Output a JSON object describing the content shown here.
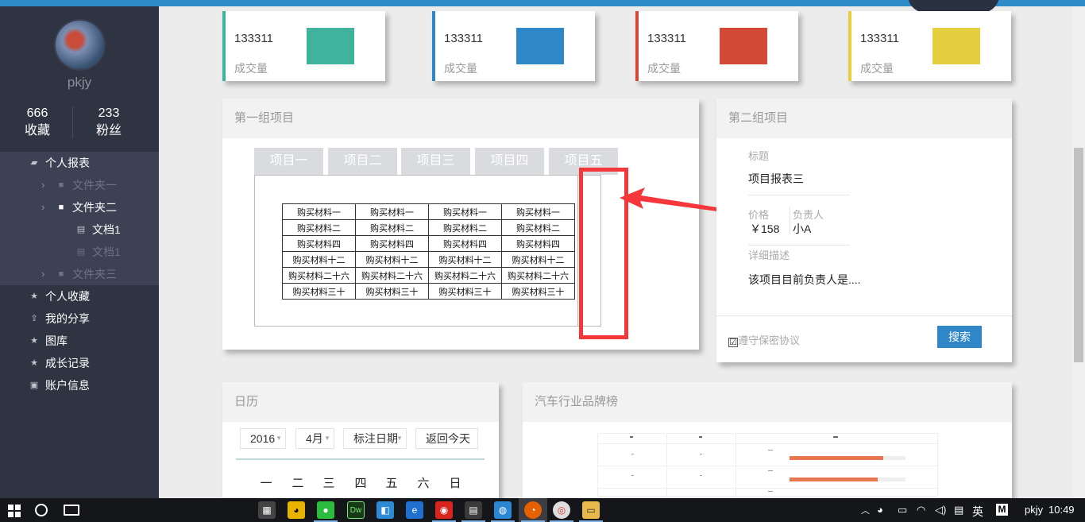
{
  "user": {
    "name": "pkjy",
    "favorites_count": "666",
    "favorites_label": "收藏",
    "fans_count": "233",
    "fans_label": "粉丝"
  },
  "sidebar": {
    "items": [
      {
        "label": "个人报表",
        "icon": "report-icon"
      },
      {
        "label": "文件夹一",
        "icon": "folder-icon"
      },
      {
        "label": "文件夹二",
        "icon": "folder-icon"
      },
      {
        "label": "文档1",
        "icon": "document-icon"
      },
      {
        "label": "文档1",
        "icon": "document-icon"
      },
      {
        "label": "文件夹三",
        "icon": "folder-icon"
      },
      {
        "label": "个人收藏",
        "icon": "star-icon"
      },
      {
        "label": "我的分享",
        "icon": "share-icon"
      },
      {
        "label": "图库",
        "icon": "star-icon"
      },
      {
        "label": "成长记录",
        "icon": "star-icon"
      },
      {
        "label": "账户信息",
        "icon": "account-icon"
      }
    ]
  },
  "stat_cards": [
    {
      "value": "133311",
      "label": "成交量",
      "color": "#3fb39b"
    },
    {
      "value": "133311",
      "label": "成交量",
      "color": "#2f87c7"
    },
    {
      "value": "133311",
      "label": "成交量",
      "color": "#d24a36"
    },
    {
      "value": "133311",
      "label": "成交量",
      "color": "#e5cf3f"
    }
  ],
  "group1": {
    "title": "第一组项目",
    "tabs": [
      "项目一",
      "项目二",
      "项目三",
      "项目四",
      "项目五"
    ],
    "table": [
      [
        "购买材料一",
        "购买材料一",
        "购买材料一",
        "购买材料一"
      ],
      [
        "购买材料二",
        "购买材料二",
        "购买材料二",
        "购买材料二"
      ],
      [
        "购买材料四",
        "购买材料四",
        "购买材料四",
        "购买材料四"
      ],
      [
        "购买材料十二",
        "购买材料十二",
        "购买材料十二",
        "购买材料十二"
      ],
      [
        "购买材料二十六",
        "购买材料二十六",
        "购买材料二十六",
        "购买材料二十六"
      ],
      [
        "购买材料三十",
        "购买材料三十",
        "购买材料三十",
        "购买材料三十"
      ]
    ]
  },
  "group2": {
    "title": "第二组项目",
    "title_label": "标题",
    "title_value": "项目报表三",
    "price_label": "价格",
    "price_value": "￥158",
    "owner_label": "负责人",
    "owner_value": "小A",
    "desc_label": "详细描述",
    "desc_value": "该项目目前负责人是....",
    "agree_label": "遵守保密协议",
    "agree_checked": "☑",
    "search_button": "搜索"
  },
  "calendar": {
    "title": "日历",
    "year": "2016",
    "month": "4月",
    "mark_date": "标注日期",
    "back_today": "返回今天",
    "weekdays": [
      "一",
      "二",
      "三",
      "四",
      "五",
      "六",
      "日"
    ]
  },
  "brand_rank": {
    "title": "汽车行业品牌榜",
    "bars": [
      0.81,
      0.76
    ]
  },
  "taskbar": {
    "ime": "英",
    "user": "pkjy",
    "time": "10:49"
  },
  "colors": {
    "accent": "#2f87c7",
    "sidebar": "#2f3443",
    "annotation": "#f4373b"
  }
}
